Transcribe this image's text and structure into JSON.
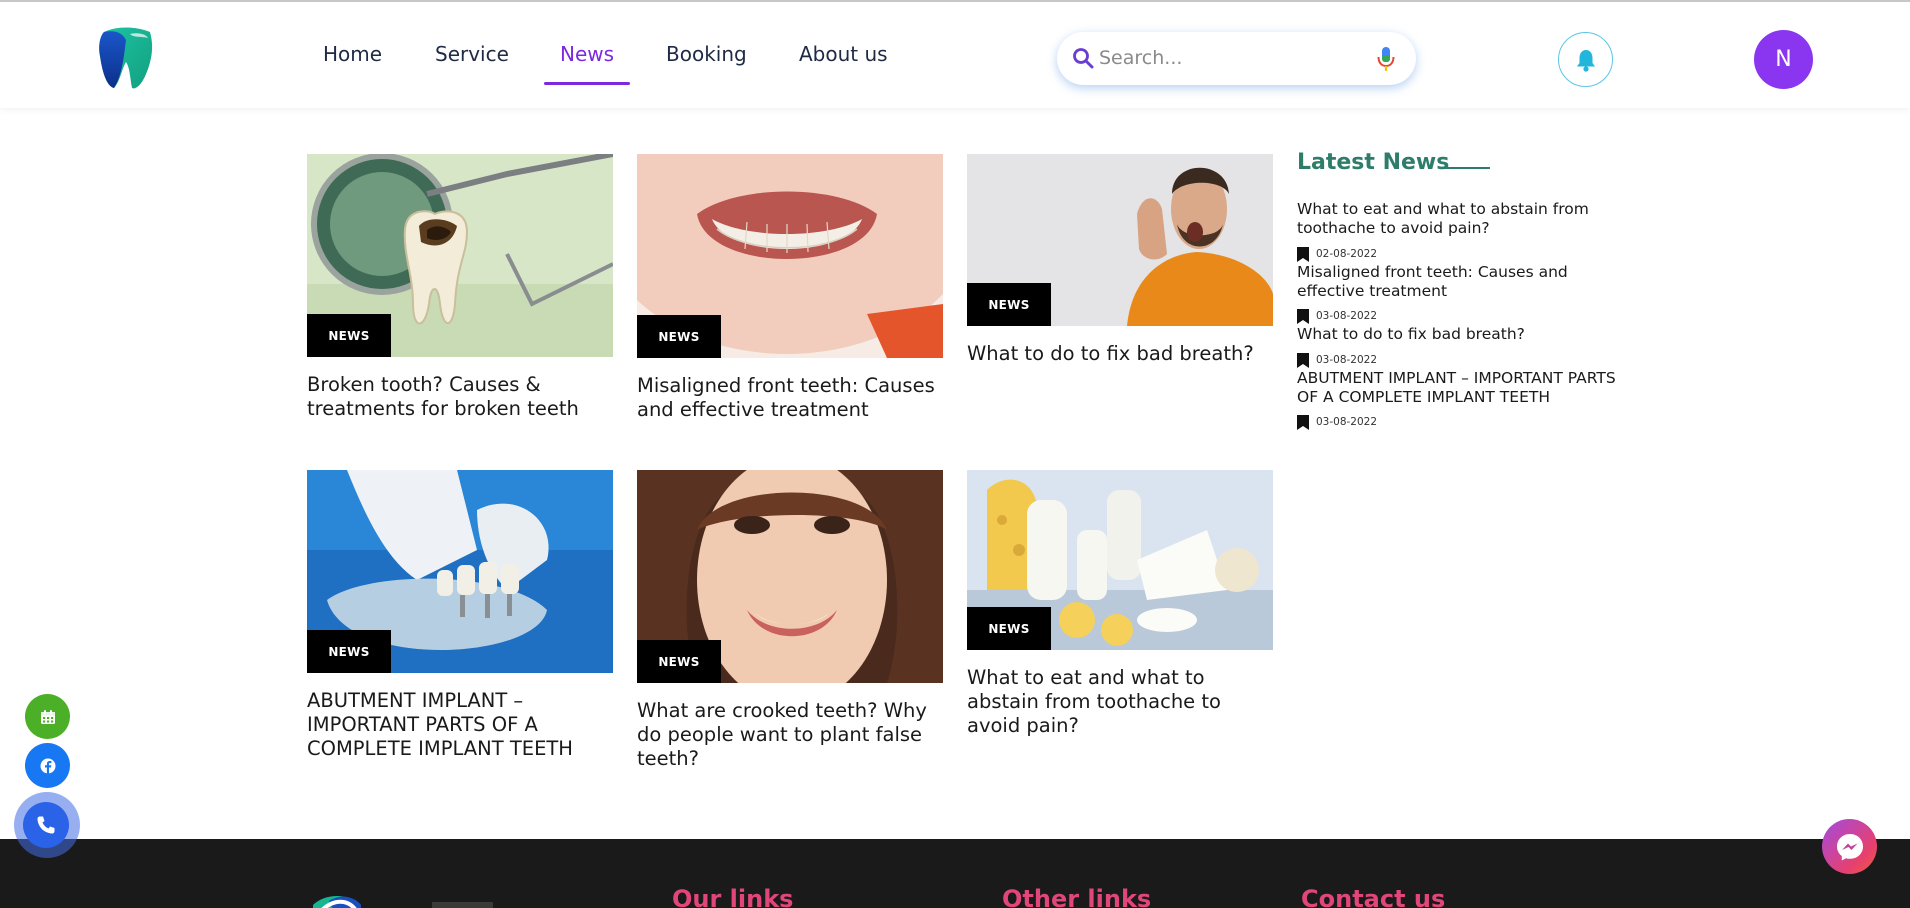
{
  "header": {
    "nav": [
      {
        "label": "Home"
      },
      {
        "label": "Service"
      },
      {
        "label": "News"
      },
      {
        "label": "Booking"
      },
      {
        "label": "About us"
      }
    ],
    "active_nav": "News",
    "search": {
      "placeholder": "Search..."
    },
    "avatar_letter": "N",
    "accent_color": "#7b2ae0"
  },
  "cards": [
    {
      "badge": "NEWS",
      "title": "Broken tooth? Causes & treatments for broken teeth",
      "image": "broken-tooth-photo"
    },
    {
      "badge": "NEWS",
      "title": "Misaligned front teeth: Causes and effective treatment",
      "image": "child-smile-photo"
    },
    {
      "badge": "NEWS",
      "title": "What to do to fix bad breath?",
      "image": "man-yawning-photo"
    },
    {
      "badge": "NEWS",
      "title": "ABUTMENT IMPLANT – IMPORTANT PARTS OF A COMPLETE IMPLANT TEETH",
      "image": "implant-model-photo"
    },
    {
      "badge": "NEWS",
      "title": "What are crooked teeth? Why do people want to plant false teeth?",
      "image": "woman-smile-photo"
    },
    {
      "badge": "NEWS",
      "title": "What to eat and what to abstain from toothache to avoid pain?",
      "image": "dairy-food-photo"
    }
  ],
  "latest_news": {
    "heading": "Latest News",
    "items": [
      {
        "title": "What to eat and what to abstain from toothache to avoid pain?",
        "date": "02-08-2022"
      },
      {
        "title": "Misaligned front teeth: Causes and effective treatment",
        "date": "03-08-2022"
      },
      {
        "title": "What to do to fix bad breath?",
        "date": "03-08-2022"
      },
      {
        "title": "ABUTMENT IMPLANT – IMPORTANT PARTS OF A COMPLETE IMPLANT TEETH",
        "date": "03-08-2022"
      }
    ]
  },
  "floating_buttons": [
    "calendar-icon",
    "facebook-icon",
    "phone-icon"
  ],
  "footer": {
    "headings": [
      "Our links",
      "Other links",
      "Contact us"
    ],
    "heading_color": "#e0467a"
  }
}
